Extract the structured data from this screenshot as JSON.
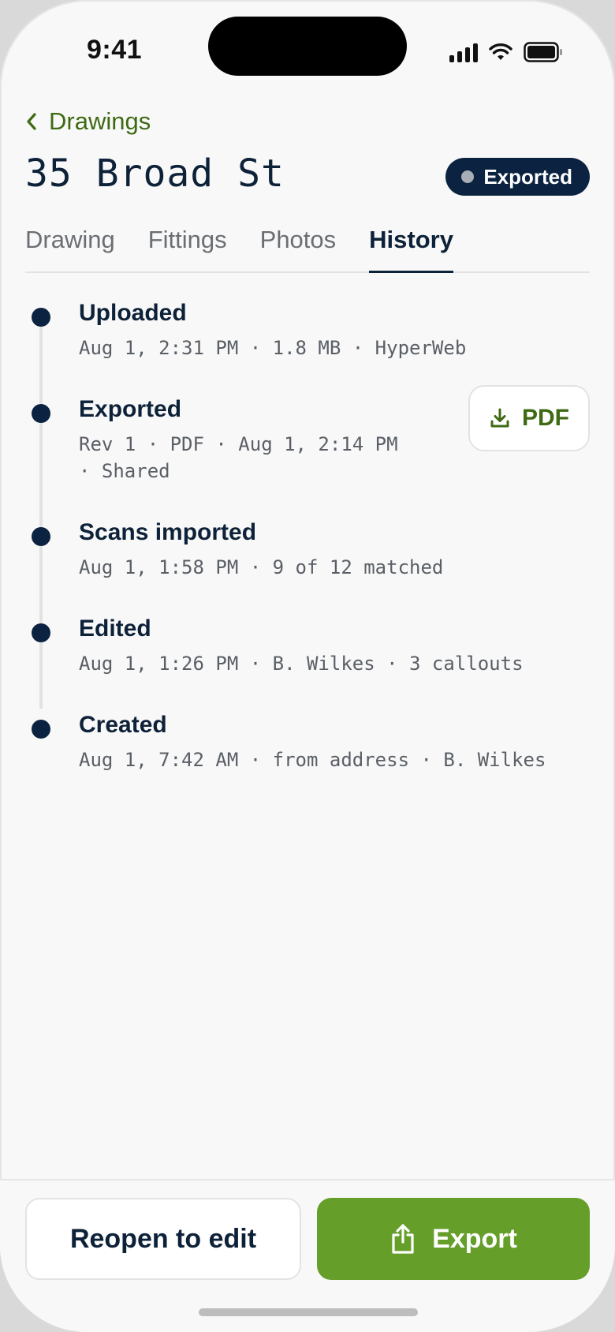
{
  "status_bar": {
    "time": "9:41"
  },
  "header": {
    "back_label": "Drawings",
    "title": "35 Broad St",
    "badge": "Exported"
  },
  "tabs": [
    {
      "label": "Drawing",
      "active": false
    },
    {
      "label": "Fittings",
      "active": false
    },
    {
      "label": "Photos",
      "active": false
    },
    {
      "label": "History",
      "active": true
    }
  ],
  "history": [
    {
      "title": "Uploaded",
      "meta": "Aug 1, 2:31 PM · 1.8 MB · HyperWeb"
    },
    {
      "title": "Exported",
      "meta": "Rev 1 · PDF · Aug 1, 2:14 PM\n· Shared",
      "action": "PDF"
    },
    {
      "title": "Scans imported",
      "meta": "Aug 1, 1:58 PM · 9 of 12 matched"
    },
    {
      "title": "Edited",
      "meta": "Aug 1, 1:26 PM · B. Wilkes · 3 callouts"
    },
    {
      "title": "Created",
      "meta": "Aug 1, 7:42 AM · from address · B. Wilkes"
    }
  ],
  "actions": {
    "reopen_label": "Reopen to edit",
    "export_label": "Export"
  },
  "colors": {
    "accent_green": "#669e2a",
    "link_green": "#3f6a14",
    "navy": "#0b2340"
  }
}
